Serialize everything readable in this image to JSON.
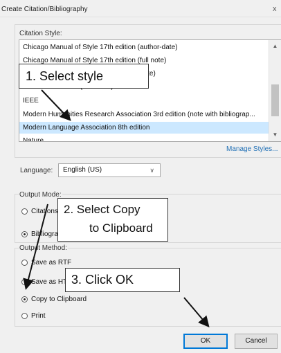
{
  "window": {
    "title": "Create Citation/Bibliography",
    "close_glyph": "x"
  },
  "citation_style": {
    "label": "Citation Style:",
    "items": [
      "Chicago Manual of Style 17th edition (author-date)",
      "Chicago Manual of Style 17th edition (full note)",
      "Chicago Manual of Style 17th edition (note)",
      "Elsevier - Harvard (with titles)",
      "IEEE",
      "Modern Humanities Research Association 3rd edition (note with bibliograp...",
      "Modern Language Association 8th edition",
      "Nature"
    ],
    "selected_index": 6,
    "manage_link": "Manage Styles..."
  },
  "language": {
    "label": "Language:",
    "value": "English (US)"
  },
  "output_mode": {
    "label": "Output Mode:",
    "options": [
      "Citations",
      "Bibliography"
    ],
    "selected": "Bibliography"
  },
  "output_method": {
    "label": "Output Method:",
    "options": [
      "Save as RTF",
      "Save as HTML",
      "Copy to Clipboard",
      "Print"
    ],
    "selected": "Copy to Clipboard"
  },
  "buttons": {
    "ok": "OK",
    "cancel": "Cancel"
  },
  "callouts": {
    "step1": "1.  Select style",
    "step2_line1": "2.  Select Copy",
    "step2_line2": "to Clipboard",
    "step3": "3.  Click OK"
  }
}
